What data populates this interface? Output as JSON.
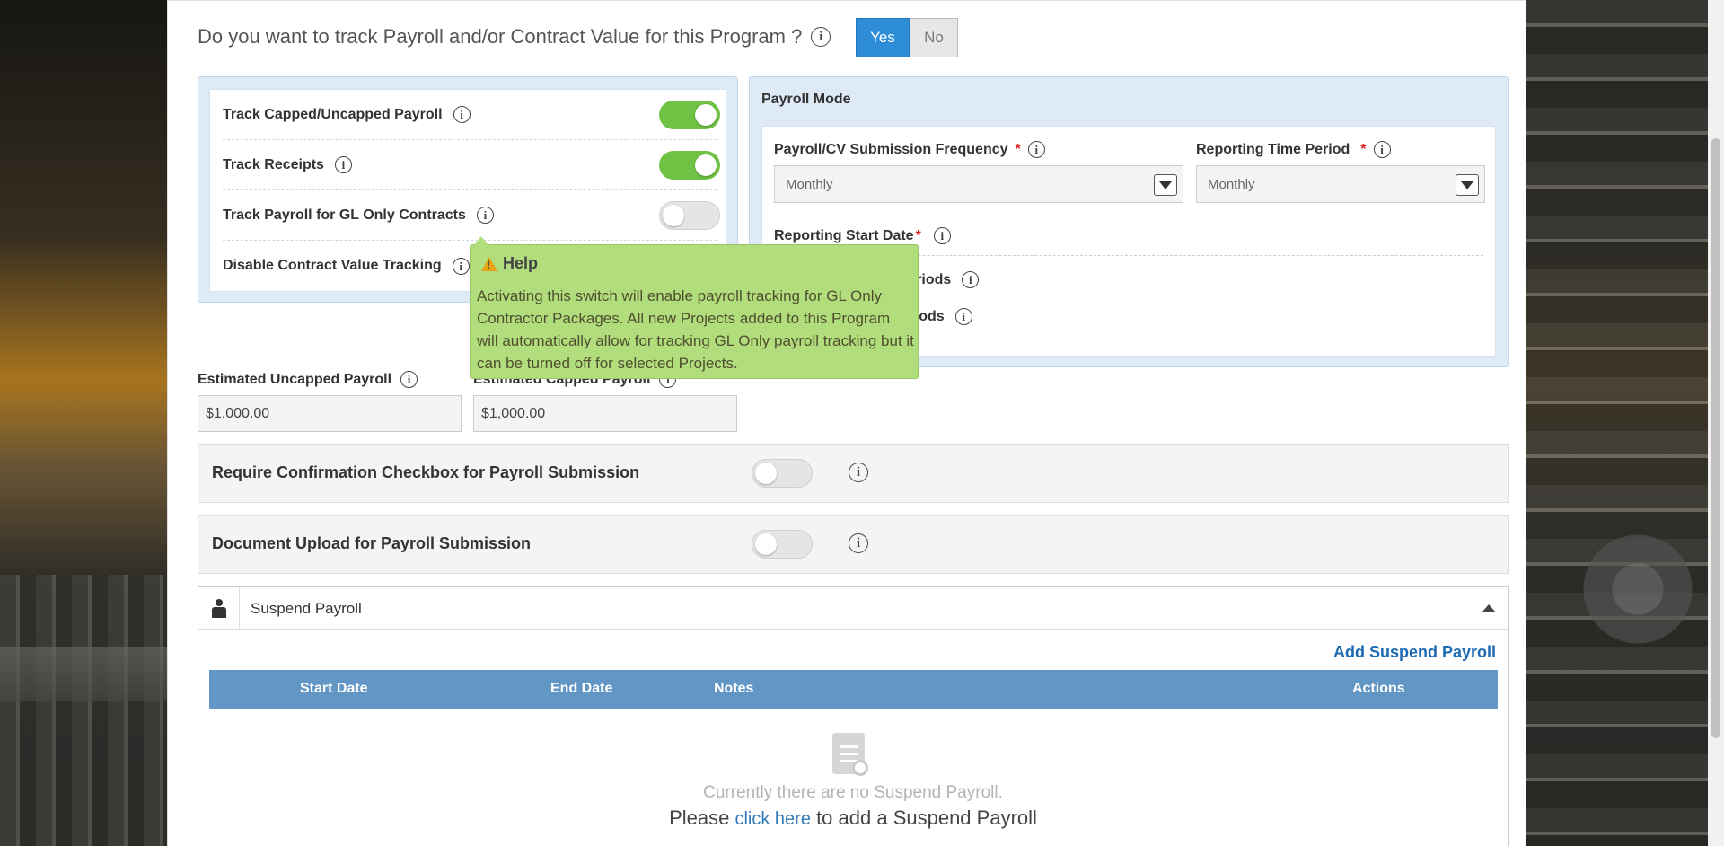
{
  "question": {
    "text": "Do you want to track Payroll and/or Contract Value for this Program ?",
    "yes": "Yes",
    "no": "No"
  },
  "toggles": [
    {
      "label": "Track Capped/Uncapped Payroll",
      "on": true
    },
    {
      "label": "Track Receipts",
      "on": true
    },
    {
      "label": "Track Payroll for GL Only Contracts",
      "on": false
    },
    {
      "label": "Disable Contract Value Tracking",
      "on": false
    }
  ],
  "payroll_mode": {
    "title": "Payroll Mode",
    "frequency_label": "Payroll/CV Submission Frequency",
    "frequency_value": "Monthly",
    "time_period_label": "Reporting Time Period",
    "time_period_value": "Monthly",
    "start_date_label": "Reporting Start Date",
    "row4_partial": "ar Periods",
    "row5_partial": "Periods",
    "required_mark": "*"
  },
  "tooltip": {
    "title": "Help",
    "body": "Activating this switch will enable payroll tracking for GL Only Contractor Packages. All new Projects added to this Program will automatically allow for tracking GL Only payroll tracking but it can be turned off for selected Projects."
  },
  "estimates": {
    "uncapped_label": "Estimated Uncapped Payroll",
    "uncapped_value": "$1,000.00",
    "capped_label": "Estimated Capped Payroll",
    "capped_value": "$1,000.00"
  },
  "bands": [
    {
      "label": "Require Confirmation Checkbox for Payroll Submission",
      "on": false
    },
    {
      "label": "Document Upload for Payroll Submission",
      "on": false
    }
  ],
  "suspend": {
    "title": "Suspend Payroll",
    "add_link": "Add Suspend Payroll",
    "columns": [
      "Start Date",
      "End Date",
      "Notes",
      "Actions"
    ],
    "empty_message": "Currently there are no Suspend Payroll.",
    "cta_prefix": "Please ",
    "cta_link": "click here",
    "cta_suffix": " to add a Suspend Payroll"
  },
  "info_glyph": "i",
  "colors": {
    "accent": "#2d8dd6",
    "toggle_on": "#6fc244",
    "tooltip": "#b2dd7c",
    "table_header": "#6196c5",
    "link": "#1d6ab3"
  }
}
